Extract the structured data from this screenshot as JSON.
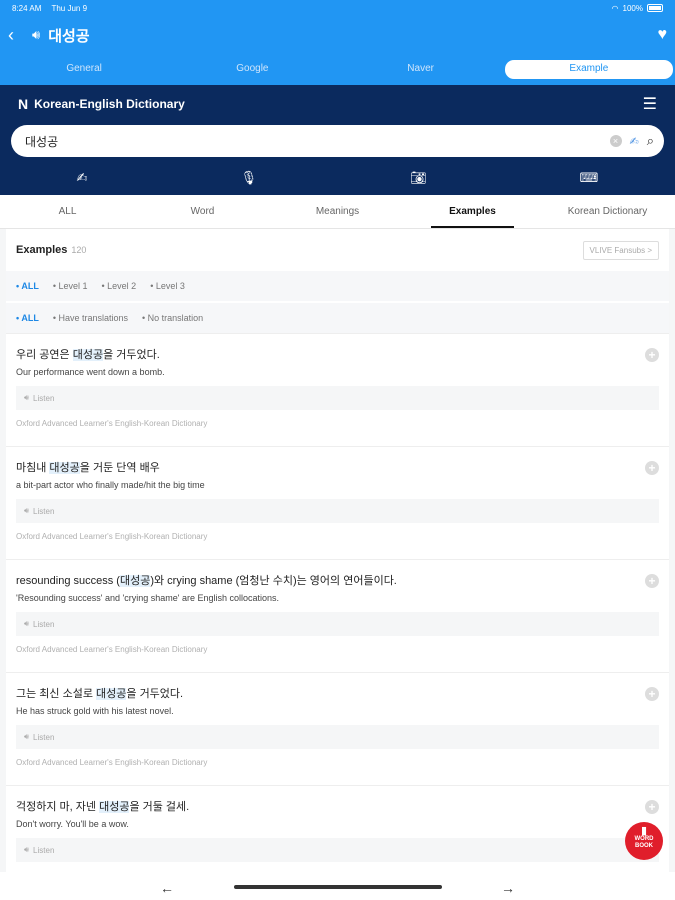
{
  "status": {
    "time": "8:24 AM",
    "date": "Thu Jun 9",
    "battery": "100%"
  },
  "header": {
    "title": "대성공"
  },
  "segments": [
    "General",
    "Google",
    "Naver",
    "Example"
  ],
  "dict": {
    "title": "Korean-English Dictionary",
    "logo": "N",
    "query": "대성공"
  },
  "tabs": [
    "ALL",
    "Word",
    "Meanings",
    "Examples",
    "Korean Dictionary"
  ],
  "examples": {
    "title": "Examples",
    "count": "120",
    "vlive": "VLIVE Fansubs >",
    "level_filters": [
      "• ALL",
      "• Level 1",
      "• Level 2",
      "• Level 3"
    ],
    "translation_filters": [
      "• ALL",
      "• Have translations",
      "• No translation"
    ],
    "listen_label": "Listen",
    "items": [
      {
        "ko_pre": "우리 공연은 ",
        "ko_hl": "대성공",
        "ko_post": "을 거두었다.",
        "en": "Our performance went down a bomb.",
        "src": "Oxford Advanced Learner's English-Korean Dictionary"
      },
      {
        "ko_pre": "마침내 ",
        "ko_hl": "대성공",
        "ko_post": "을 거둔 단역 배우",
        "en": "a bit-part actor who finally made/hit the big time",
        "src": "Oxford Advanced Learner's English-Korean Dictionary"
      },
      {
        "ko_pre": "resounding success (",
        "ko_hl": "대성공",
        "ko_post": ")와 crying shame (엄청난 수치)는 영어의 연어들이다.",
        "en": "'Resounding success' and 'crying shame' are English collocations.",
        "src": "Oxford Advanced Learner's English-Korean Dictionary"
      },
      {
        "ko_pre": "그는 최신 소설로 ",
        "ko_hl": "대성공",
        "ko_post": "을 거두었다.",
        "en": "He has struck gold with his latest novel.",
        "src": "Oxford Advanced Learner's English-Korean Dictionary"
      },
      {
        "ko_pre": "걱정하지 마, 자넨 ",
        "ko_hl": "대성공",
        "ko_post": "을 거둘 걸세.",
        "en": "Don't worry. You'll be a wow.",
        "src": ""
      }
    ]
  },
  "wordbook": {
    "label": "WORD BOOK"
  }
}
